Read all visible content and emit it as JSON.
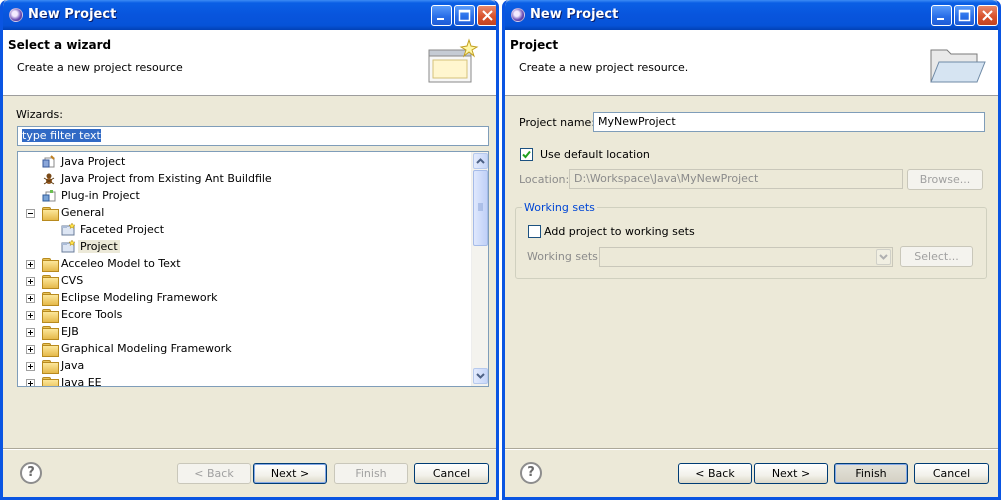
{
  "left_dialog": {
    "window_title": "New Project",
    "banner_title": "Select a wizard",
    "banner_description": "Create a new project resource",
    "wizards_label": "Wizards:",
    "filter_value": "type filter text",
    "tree_items": [
      {
        "label": "Java Project",
        "icon": "java-project-icon",
        "type": "item"
      },
      {
        "label": "Java Project from Existing Ant Buildfile",
        "icon": "ant-icon",
        "type": "item"
      },
      {
        "label": "Plug-in Project",
        "icon": "plugin-icon",
        "type": "item"
      },
      {
        "label": "General",
        "icon": "folder-open-icon",
        "type": "folder",
        "expanded": true
      },
      {
        "label": "Faceted Project",
        "icon": "project-icon",
        "type": "item"
      },
      {
        "label": "Project",
        "icon": "project-icon",
        "type": "item",
        "selected": true
      },
      {
        "label": "Acceleo Model to Text",
        "icon": "folder-icon",
        "type": "folder"
      },
      {
        "label": "CVS",
        "icon": "folder-icon",
        "type": "folder"
      },
      {
        "label": "Eclipse Modeling Framework",
        "icon": "folder-icon",
        "type": "folder"
      },
      {
        "label": "Ecore Tools",
        "icon": "folder-icon",
        "type": "folder"
      },
      {
        "label": "EJB",
        "icon": "folder-icon",
        "type": "folder"
      },
      {
        "label": "Graphical Modeling Framework",
        "icon": "folder-icon",
        "type": "folder"
      },
      {
        "label": "Java",
        "icon": "folder-icon",
        "type": "folder"
      },
      {
        "label": "Java EE",
        "icon": "folder-icon",
        "type": "folder"
      }
    ],
    "buttons": {
      "back": "< Back",
      "next": "Next >",
      "finish": "Finish",
      "cancel": "Cancel"
    },
    "help_icon": "?"
  },
  "right_dialog": {
    "window_title": "New Project",
    "banner_title": "Project",
    "banner_description": "Create a new project resource.",
    "project_name_label": "Project name:",
    "project_name_value": "MyNewProject",
    "use_default_location_label": "Use default location",
    "use_default_location_checked": true,
    "location_label": "Location:",
    "location_value": "D:\\Workspace\\Java\\MyNewProject",
    "browse_label": "Browse...",
    "working_sets_group_title": "Working sets",
    "add_to_working_sets_label": "Add project to working sets",
    "add_to_working_sets_checked": false,
    "working_sets_label": "Working sets:",
    "select_label": "Select...",
    "buttons": {
      "back": "< Back",
      "next": "Next >",
      "finish": "Finish",
      "cancel": "Cancel"
    },
    "help_icon": "?"
  },
  "colors": {
    "titlebar": "#0855dd",
    "selection": "#316ac5",
    "dialog_bg": "#ece9d8",
    "group_title": "#0046d5"
  }
}
